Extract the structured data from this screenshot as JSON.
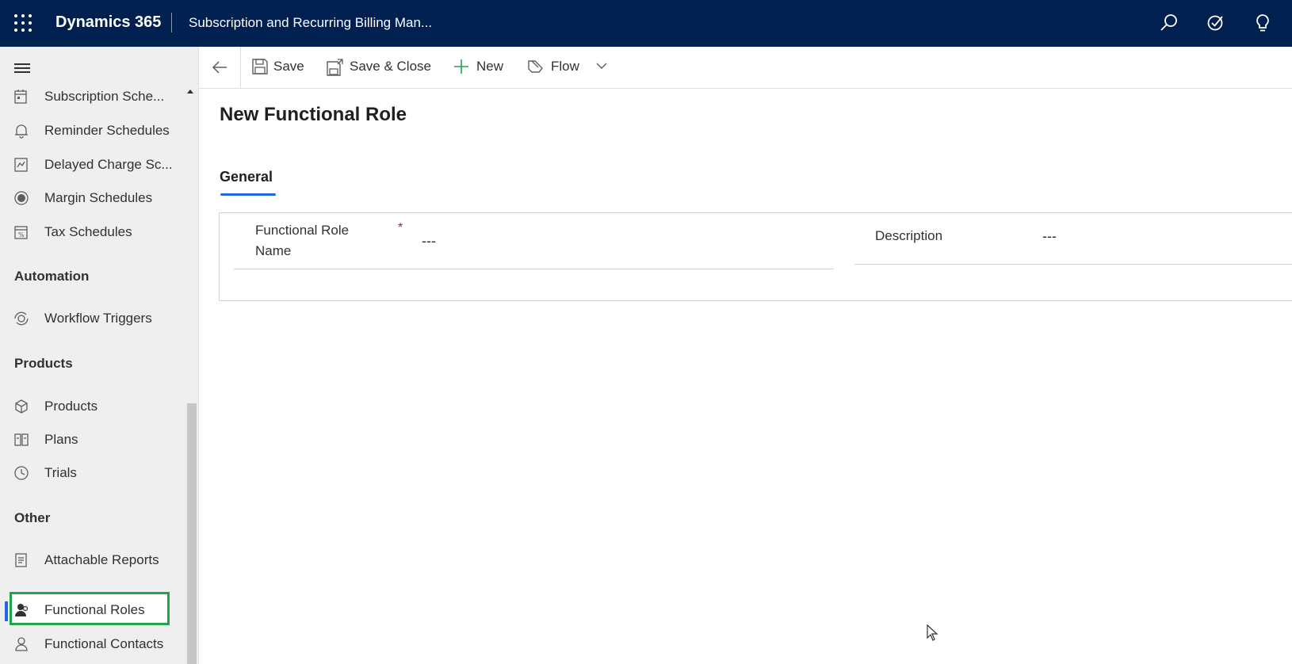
{
  "topbar": {
    "brand": "Dynamics 365",
    "app_title": "Subscription and Recurring Billing Man...",
    "icons": [
      "waffle-icon",
      "search-icon",
      "task-flow-icon",
      "lightbulb-icon"
    ]
  },
  "sidebar": {
    "items_top": [
      {
        "label": "Subscription Sche...",
        "icon": "subscription-schedule-icon"
      },
      {
        "label": "Reminder Schedules",
        "icon": "reminder-schedule-icon"
      },
      {
        "label": "Delayed Charge Sc...",
        "icon": "delayed-charge-icon"
      },
      {
        "label": "Margin Schedules",
        "icon": "margin-schedule-icon"
      },
      {
        "label": "Tax Schedules",
        "icon": "tax-schedule-icon"
      }
    ],
    "groups": [
      {
        "header": "Automation",
        "items": [
          {
            "label": "Workflow Triggers",
            "icon": "workflow-trigger-icon"
          }
        ]
      },
      {
        "header": "Products",
        "items": [
          {
            "label": "Products",
            "icon": "product-box-icon"
          },
          {
            "label": "Plans",
            "icon": "plan-icon"
          },
          {
            "label": "Trials",
            "icon": "trial-icon"
          }
        ]
      },
      {
        "header": "Other",
        "items": [
          {
            "label": "Attachable Reports",
            "icon": "report-icon"
          },
          {
            "label": "Functional Roles",
            "icon": "functional-role-icon",
            "selected": true
          },
          {
            "label": "Functional Contacts",
            "icon": "contact-icon"
          }
        ]
      }
    ],
    "highlight_color": "#23a34a",
    "selected_bar_color": "#2266e3"
  },
  "commandbar": {
    "save": "Save",
    "save_close": "Save & Close",
    "new": "New",
    "flow": "Flow"
  },
  "form": {
    "title": "New Functional Role",
    "tab": "General",
    "fields": {
      "name_label_line1": "Functional Role",
      "name_label_line2": "Name",
      "name_required": "*",
      "name_value": "---",
      "description_label": "Description",
      "description_value": "---"
    }
  },
  "colors": {
    "topbar_bg": "#002050",
    "accent": "#2266e3",
    "required": "#a4262c"
  }
}
